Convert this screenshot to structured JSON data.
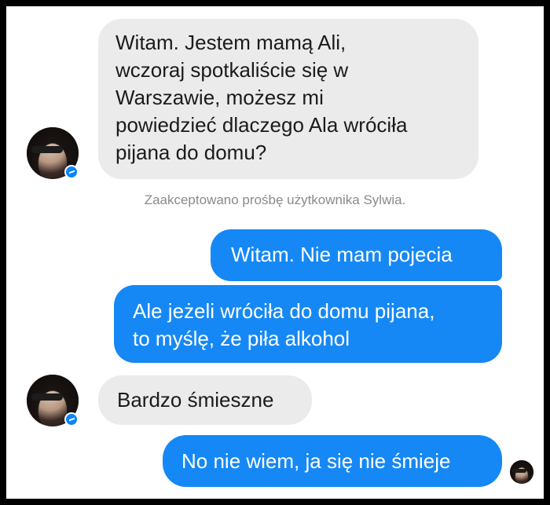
{
  "messages": {
    "first": {
      "lines": [
        "Witam. Jestem mamą Ali,",
        "wczoraj spotkaliście się w",
        "Warszawie, możesz mi",
        "powiedzieć dlaczego Ala wróciła",
        "pijana do domu?"
      ]
    },
    "system": "Zaakceptowano prośbę użytkownika Sylwia.",
    "reply1": "Witam. Nie mam pojecia",
    "reply2": {
      "lines": [
        "Ale jeżeli wróciła do domu pijana,",
        "to myślę, że piła alkohol"
      ]
    },
    "response": "Bardzo śmieszne",
    "reply3": "No nie wiem, ja się nie śmieje"
  },
  "colors": {
    "incoming_bubble": "#ebebeb",
    "outgoing_bubble": "#1588f5",
    "badge": "#0a84ff"
  },
  "icons": {
    "avatar": "user-avatar",
    "badge": "messenger-badge-icon"
  }
}
